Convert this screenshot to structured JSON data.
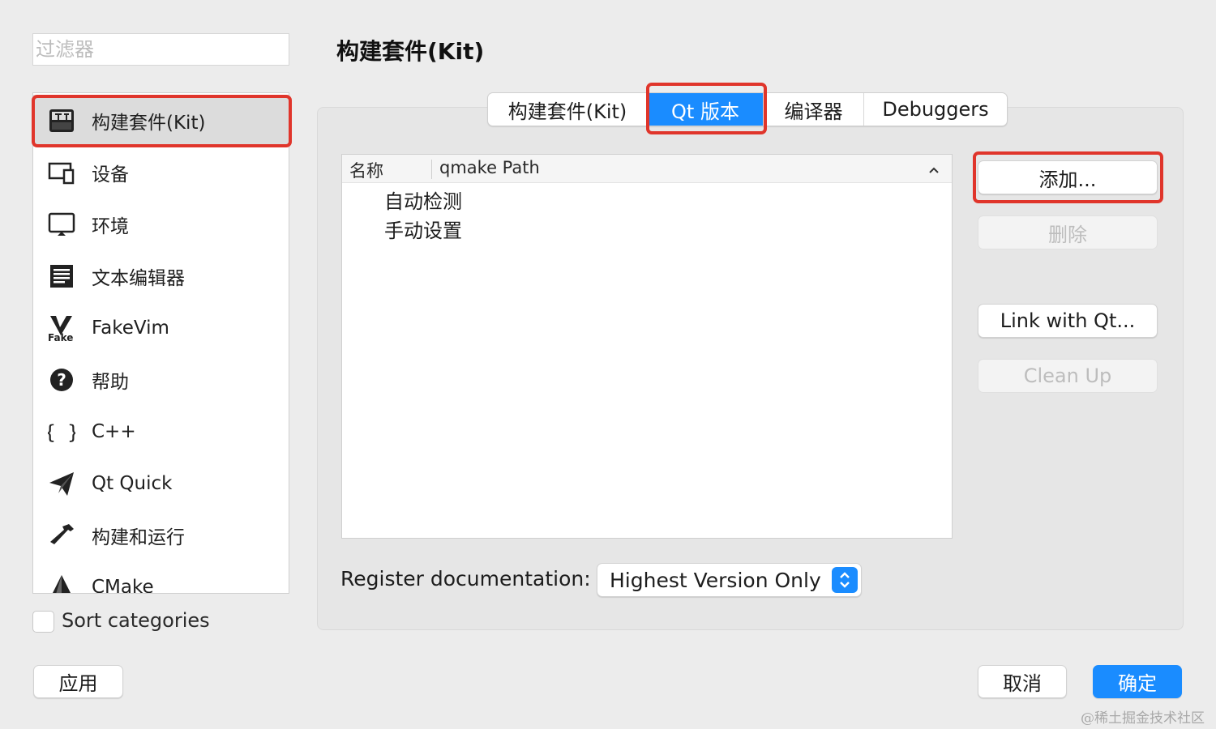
{
  "filter": {
    "placeholder": "过滤器"
  },
  "sidebar": {
    "items": [
      {
        "label": "构建套件(Kit)",
        "icon": "kit-icon",
        "selected": true
      },
      {
        "label": "设备",
        "icon": "device-icon"
      },
      {
        "label": "环境",
        "icon": "monitor-icon"
      },
      {
        "label": "文本编辑器",
        "icon": "text-editor-icon"
      },
      {
        "label": "FakeVim",
        "icon": "fakevim-icon"
      },
      {
        "label": "帮助",
        "icon": "help-icon"
      },
      {
        "label": "C++",
        "icon": "braces-icon"
      },
      {
        "label": "Qt Quick",
        "icon": "paper-plane-icon"
      },
      {
        "label": "构建和运行",
        "icon": "hammer-icon"
      },
      {
        "label": "CMake",
        "icon": "cmake-icon"
      }
    ],
    "sort_label": "Sort categories"
  },
  "footer": {
    "apply_label": "应用",
    "cancel_label": "取消",
    "ok_label": "确定"
  },
  "main": {
    "title": "构建套件(Kit)",
    "tabs": [
      {
        "label": "构建套件(Kit)"
      },
      {
        "label": "Qt 版本",
        "active": true
      },
      {
        "label": "编译器"
      },
      {
        "label": "Debuggers"
      }
    ],
    "table": {
      "columns": [
        "名称",
        "qmake Path"
      ],
      "rows": [
        "自动检测",
        "手动设置"
      ]
    },
    "buttons": {
      "add": "添加...",
      "remove": "删除",
      "link": "Link with Qt...",
      "cleanup": "Clean Up"
    },
    "register": {
      "label": "Register documentation:",
      "value": "Highest Version Only"
    }
  },
  "watermark": "@稀土掘金技术社区",
  "colors": {
    "accent": "#1a8cff",
    "highlight": "#e0352b"
  }
}
